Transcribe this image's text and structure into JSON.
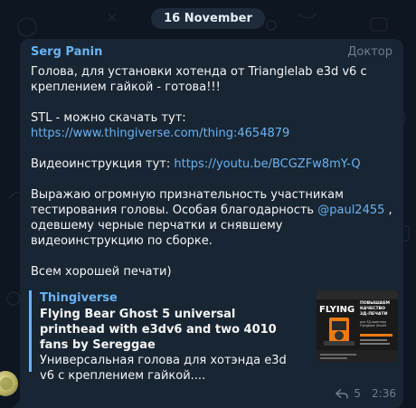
{
  "date_separator": "16 November",
  "message": {
    "author": "Serg Panin",
    "role": "Доктор",
    "paragraph1": "Голова, для установки хотенда от Trianglelab e3d v6 с креплением гайкой - готова!!!",
    "stl_prefix": "STL - можно скачать тут: ",
    "stl_link": "https://www.thingiverse.com/thing:4654879",
    "video_prefix": "Видеоинструкция тут: ",
    "video_link": "https://youtu.be/BCGZFw8mY-Q",
    "thanks_part1": "Выражаю огромную признательность участникам тестирования головы. Особая благодарность ",
    "mention": "@paul2455",
    "thanks_part2": " , одевшему черные перчатки и снявшему видеоинструкцию по сборке.",
    "closing": "Всем хорошей печати)"
  },
  "link_preview": {
    "site": "Thingiverse",
    "title": "Flying Bear Ghost 5 universal printhead with e3dv6 and two 4010 fans by Sereggae",
    "description": "Универсальная голова для хотэнда e3d v6 с креплением гайкой....",
    "thumbnail_text": {
      "brand": "FLYING",
      "heading": "ПОВЫШАЕМ КАЧЕСТВО 3Д-ПЕЧАТИ",
      "subheading": "для 3Д-принтера Flyingbear Ghost5"
    }
  },
  "footer": {
    "reply_icon": "reply-icon",
    "reply_count": "5",
    "time": "2:36"
  },
  "colors": {
    "background": "#0e1621",
    "bubble": "#182533",
    "accent": "#6ab3f3",
    "muted": "#6d7f8f"
  }
}
